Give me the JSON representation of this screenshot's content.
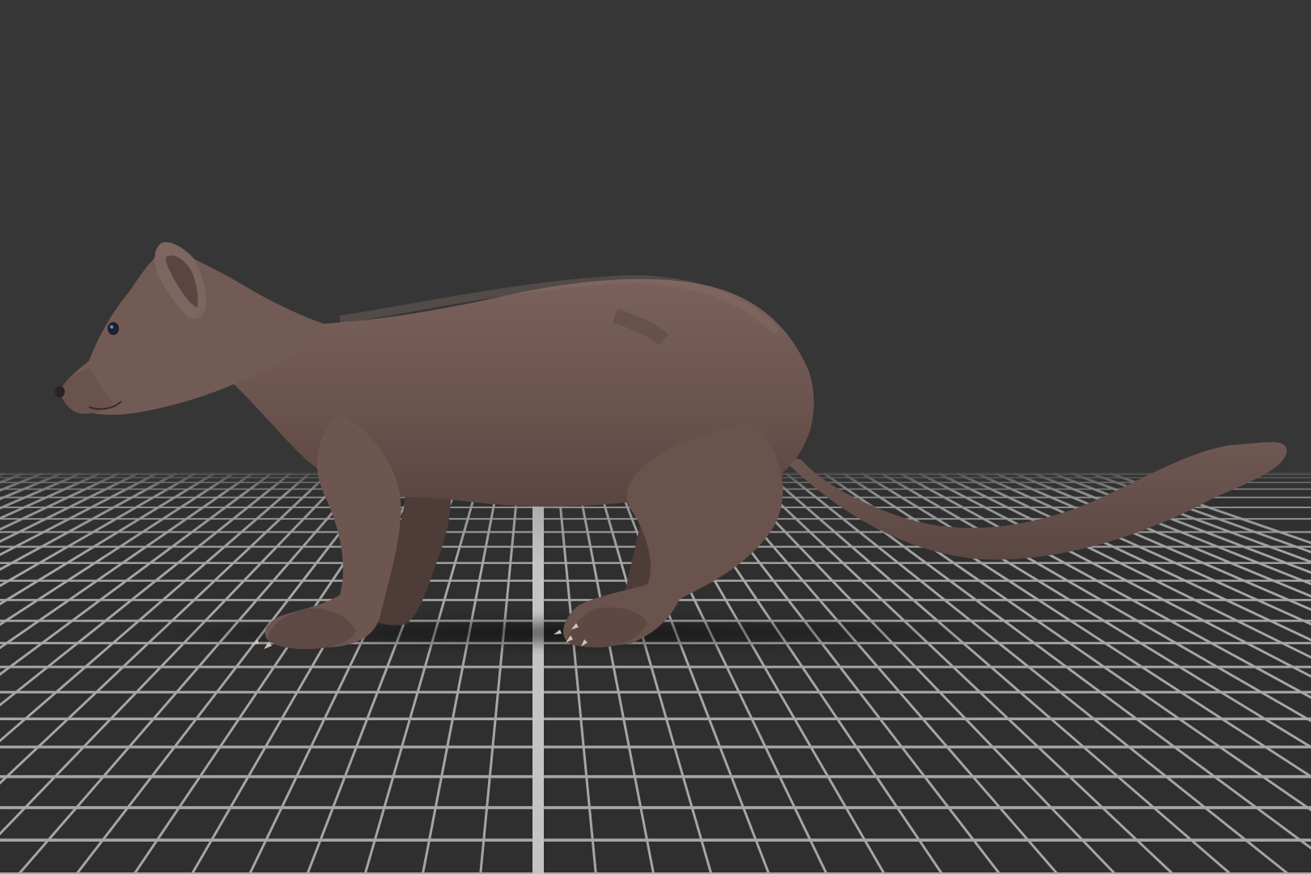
{
  "scene": {
    "background_color": "#363636",
    "floor_color": "#2e2e2e",
    "grid_line_color": "#a6a6a6",
    "grid_axis_color": "#c4c4c4",
    "subject": "marten-3d-model",
    "fur_base_color": "#6e5650",
    "fur_light_color": "#8a716a",
    "fur_dark_color": "#4a3834"
  }
}
